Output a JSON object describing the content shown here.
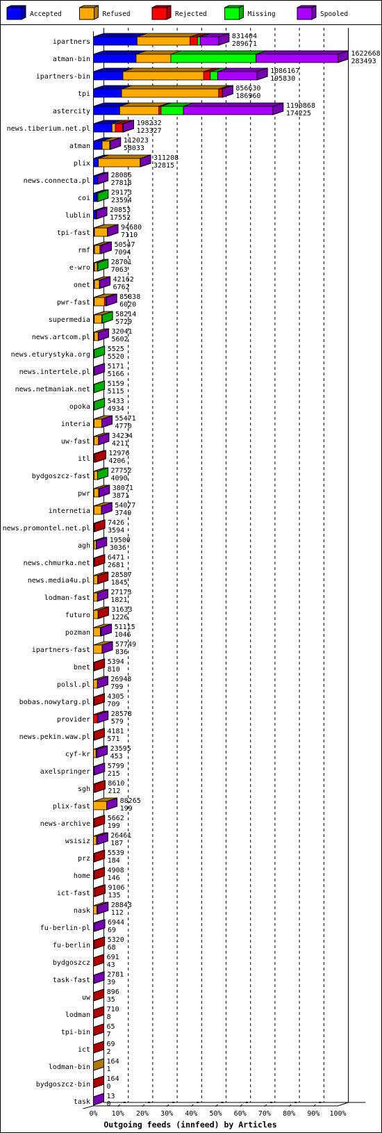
{
  "chart_data": {
    "type": "bar",
    "orientation": "horizontal",
    "stacked": true,
    "style": "3d",
    "title": "",
    "xlabel": "Outgoing feeds (innfeed) by Articles",
    "ylabel": "",
    "xlim": [
      0,
      100
    ],
    "x_units": "percent of largest total",
    "xticks": [
      "0%",
      "10%",
      "20%",
      "30%",
      "40%",
      "50%",
      "60%",
      "70%",
      "80%",
      "90%",
      "100%"
    ],
    "grid": "vertical dashed",
    "legend_position": "top",
    "value_labels": "each bar shows its total (upper) and its Accepted count (lower)",
    "categories": [
      "ipartners",
      "atman-bin",
      "ipartners-bin",
      "tpi",
      "astercity",
      "news.tiberium.net.pl",
      "atman",
      "plix",
      "news.connecta.pl",
      "coi",
      "lublin",
      "tpi-fast",
      "rmf",
      "e-wro",
      "onet",
      "pwr-fast",
      "supermedia",
      "news.artcom.pl",
      "news.eturystyka.org",
      "news.intertele.pl",
      "news.netmaniak.net",
      "opoka",
      "interia",
      "uw-fast",
      "itl",
      "bydgoszcz-fast",
      "pwr",
      "internetia",
      "news.promontel.net.pl",
      "agh",
      "news.chmurka.net",
      "news.media4u.pl",
      "lodman-fast",
      "futuro",
      "pozman",
      "ipartners-fast",
      "bnet",
      "polsl.pl",
      "bobas.nowytarg.pl",
      "provider",
      "news.pekin.waw.pl",
      "cyf-kr",
      "axelspringer",
      "sgh",
      "plix-fast",
      "news-archive",
      "wsisiz",
      "prz",
      "home",
      "ict-fast",
      "nask",
      "fu-berlin-pl",
      "fu-berlin",
      "bydgoszcz",
      "task-fast",
      "uw",
      "lodman",
      "tpi-bin",
      "ict",
      "lodman-bin",
      "bydgoszcz-bin",
      "task"
    ],
    "totals": [
      831404,
      1622668,
      1086167,
      856630,
      1190868,
      198232,
      112023,
      311208,
      28086,
      29173,
      20853,
      94680,
      50547,
      28701,
      42162,
      85838,
      58214,
      32041,
      5525,
      5171,
      5159,
      5433,
      55471,
      34234,
      12976,
      27752,
      38071,
      54077,
      7426,
      19500,
      6471,
      28587,
      27173,
      31633,
      51115,
      57749,
      5394,
      26948,
      4305,
      28578,
      4181,
      23595,
      5799,
      8610,
      88265,
      5662,
      26461,
      5539,
      4908,
      9106,
      28843,
      6944,
      5320,
      691,
      2781,
      896,
      710,
      65,
      69,
      164,
      164,
      13
    ],
    "series": [
      {
        "name": "Accepted",
        "color": "#0000ff",
        "side_color": "#0000a8",
        "values": [
          289671,
          283493,
          195830,
          186960,
          174225,
          123327,
          58033,
          32815,
          27818,
          23594,
          17552,
          7110,
          7094,
          7063,
          6762,
          6020,
          5729,
          5602,
          5520,
          5166,
          5115,
          4934,
          4770,
          4211,
          4206,
          4090,
          3871,
          3749,
          3594,
          3036,
          2681,
          1845,
          1821,
          1226,
          1046,
          836,
          810,
          799,
          709,
          579,
          571,
          453,
          215,
          212,
          199,
          199,
          187,
          184,
          146,
          135,
          112,
          69,
          68,
          43,
          39,
          35,
          8,
          7,
          2,
          1,
          0,
          0
        ]
      },
      {
        "name": "Refused",
        "color": "#ffaa00",
        "side_color": "#b07800",
        "values": [
          352000,
          230500,
          536000,
          644400,
          260100,
          22700,
          50000,
          277400,
          0,
          0,
          0,
          85000,
          36000,
          19000,
          33000,
          67000,
          50000,
          26000,
          0,
          0,
          0,
          0,
          50000,
          29600,
          0,
          23000,
          31000,
          49800,
          0,
          16000,
          0,
          26000,
          25000,
          30000,
          45000,
          56500,
          0,
          26000,
          0,
          0,
          0,
          17000,
          0,
          0,
          88000,
          0,
          20000,
          0,
          0,
          0,
          23000,
          0,
          0,
          0,
          0,
          0,
          0,
          0,
          0,
          163,
          0,
          0
        ]
      },
      {
        "name": "Rejected",
        "color": "#ff0000",
        "side_color": "#b00000",
        "values": [
          49000,
          0,
          44000,
          23180,
          14800,
          47300,
          0,
          0,
          0,
          0,
          0,
          0,
          0,
          0,
          0,
          10000,
          0,
          0,
          0,
          0,
          0,
          0,
          0,
          0,
          8770,
          0,
          2800,
          0,
          3832,
          0,
          3790,
          742,
          0,
          407,
          2000,
          0,
          4584,
          0,
          3596,
          26000,
          3610,
          0,
          0,
          8398,
          0,
          5463,
          0,
          5355,
          4762,
          8971,
          0,
          0,
          5252,
          648,
          0,
          861,
          702,
          58,
          67,
          0,
          164,
          0
        ]
      },
      {
        "name": "Missing",
        "color": "#00ff00",
        "side_color": "#00b000",
        "values": [
          18500,
          565000,
          48500,
          0,
          147900,
          0,
          0,
          0,
          0,
          5579,
          0,
          0,
          0,
          2638,
          0,
          0,
          2485,
          0,
          5,
          0,
          44,
          499,
          0,
          0,
          0,
          662,
          0,
          0,
          0,
          0,
          0,
          0,
          0,
          0,
          0,
          0,
          0,
          0,
          0,
          0,
          0,
          0,
          0,
          0,
          0,
          0,
          0,
          0,
          0,
          0,
          0,
          0,
          0,
          0,
          0,
          0,
          0,
          0,
          0,
          0,
          0,
          0
        ]
      },
      {
        "name": "Spooled",
        "color": "#aa00ff",
        "side_color": "#7700b0",
        "values": [
          122233,
          543675,
          261837,
          2090,
          593843,
          4905,
          3990,
          993,
          268,
          0,
          3301,
          2570,
          7453,
          0,
          2400,
          2818,
          0,
          439,
          0,
          5,
          0,
          0,
          701,
          423,
          0,
          0,
          400,
          528,
          0,
          464,
          0,
          0,
          352,
          0,
          3069,
          413,
          0,
          149,
          0,
          1999,
          0,
          6142,
          5584,
          0,
          66,
          0,
          6274,
          0,
          0,
          0,
          5731,
          6875,
          0,
          0,
          2742,
          0,
          0,
          0,
          0,
          0,
          0,
          13
        ]
      }
    ]
  }
}
